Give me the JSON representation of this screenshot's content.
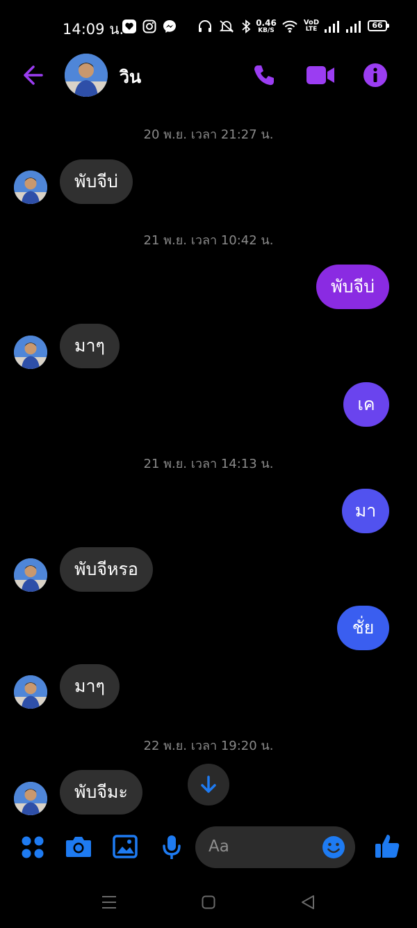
{
  "status_bar": {
    "time": "14:09 น.",
    "network_speed_value": "0.46",
    "network_speed_unit": "KB/S",
    "volte_top": "VoD",
    "volte_bottom": "LTE",
    "battery": "66"
  },
  "header": {
    "contact_name": "วิน"
  },
  "messages": {
    "ts1": "20 พ.ย. เวลา 21:27 น.",
    "m1": "พับจีบ่",
    "ts2": "21 พ.ย. เวลา 10:42 น.",
    "m2": "พับจีบ่",
    "m3": "มาๆ",
    "m4": "เค",
    "ts3": "21 พ.ย. เวลา 14:13 น.",
    "m5": "มา",
    "m6": "พับจีหรอ",
    "m7": "ชั่ย",
    "m8": "มาๆ",
    "ts4": "22 พ.ย. เวลา 19:20 น.",
    "m9": "พับจีมะ"
  },
  "composer": {
    "placeholder": "Aa"
  },
  "colors": {
    "accent_purple": "#9b3df2",
    "out_purple": "#8a2be2",
    "out_indigo": "#6a44ee",
    "out_blue": "#3a5ef0",
    "blue_icon": "#1e7bf2"
  },
  "icons": {
    "back": "back-arrow-icon",
    "call": "phone-icon",
    "video": "video-camera-icon",
    "info": "info-icon",
    "scroll": "arrow-down-icon",
    "apps": "apps-grid-icon",
    "camera": "camera-icon",
    "gallery": "image-icon",
    "mic": "microphone-icon",
    "emoji": "emoji-icon",
    "like": "thumbs-up-icon"
  }
}
